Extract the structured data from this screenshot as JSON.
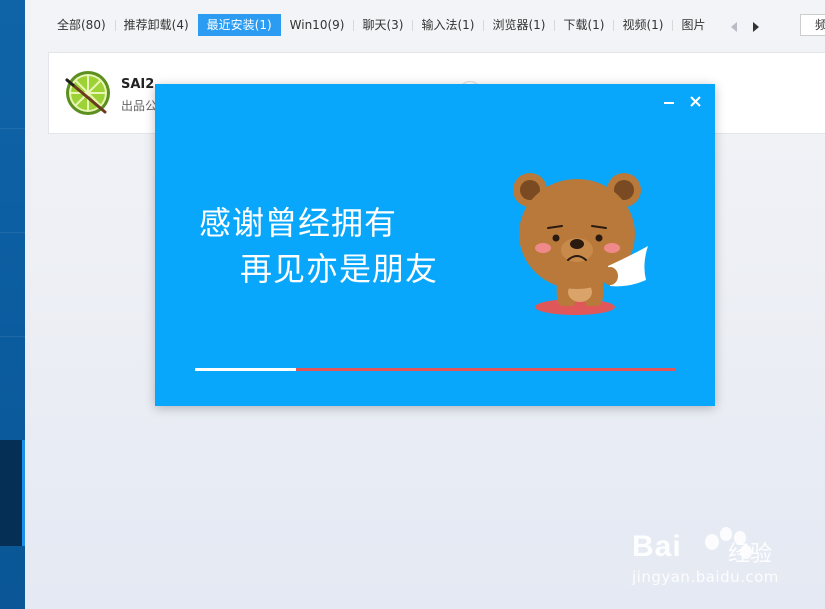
{
  "tabs": [
    {
      "label": "全部(80)"
    },
    {
      "label": "推荐卸载(4)"
    },
    {
      "label": "最近安装(1)"
    },
    {
      "label": "Win10(9)"
    },
    {
      "label": "聊天(3)"
    },
    {
      "label": "输入法(1)"
    },
    {
      "label": "浏览器(1)"
    },
    {
      "label": "下载(1)"
    },
    {
      "label": "视频(1)"
    },
    {
      "label": "图片"
    }
  ],
  "active_tab_index": 2,
  "corner_button_label": "频",
  "app": {
    "name": "SAI2",
    "publisher_prefix": "出品公"
  },
  "dialog": {
    "line1": "感谢曾经拥有",
    "line2": "再见亦是朋友",
    "progress_fraction": 0.21
  },
  "watermark": {
    "brand": "Bai",
    "brand_cn": "经验",
    "url": "jingyan.baidu.com"
  },
  "colors": {
    "dialog_bg": "#08a7fb",
    "active_tab": "#2b9cf2",
    "progress_track": "#e0575a",
    "rail": "#0b5da0"
  }
}
